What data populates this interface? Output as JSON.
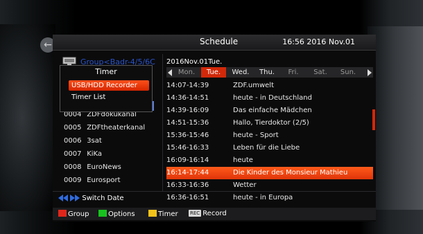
{
  "header": {
    "title": "Schedule",
    "clock": "16:56 2016 Nov.01"
  },
  "left": {
    "satellite": "Group<Badr-4/5/6C",
    "channels": [
      {
        "num": "0004",
        "name": "ZDFdokukanal"
      },
      {
        "num": "0005",
        "name": "ZDFtheaterkanal"
      },
      {
        "num": "0006",
        "name": "3sat"
      },
      {
        "num": "0007",
        "name": "KiKa"
      },
      {
        "num": "0008",
        "name": "EuroNews"
      },
      {
        "num": "0009",
        "name": "Eurosport"
      }
    ],
    "partial": [
      "0",
      "(",
      "("
    ]
  },
  "popup": {
    "title": "Timer",
    "items": [
      {
        "label": "USB/HDD Recorder",
        "selected": true
      },
      {
        "label": "Timer List",
        "selected": false
      }
    ]
  },
  "schedule": {
    "date": "2016Nov.01Tue.",
    "days": [
      "Mon.",
      "Tue.",
      "Wed.",
      "Thu.",
      "Fri.",
      "Sat.",
      "Sun."
    ],
    "selected_day": "Tue.",
    "events": [
      {
        "time": "14:07-14:39",
        "name": "ZDF.umwelt"
      },
      {
        "time": "14:36-14:51",
        "name": "heute - in Deutschland"
      },
      {
        "time": "14:39-16:09",
        "name": "Das einfache Mädchen"
      },
      {
        "time": "14:51-15:36",
        "name": "Hallo, Tierdoktor (2/5)"
      },
      {
        "time": "15:36-15:46",
        "name": "heute - Sport"
      },
      {
        "time": "15:46-16:33",
        "name": "Leben für die Liebe"
      },
      {
        "time": "16:09-16:14",
        "name": "heute"
      },
      {
        "time": "16:14-17:44",
        "name": "Die Kinder des Monsieur Mathieu",
        "selected": true
      },
      {
        "time": "16:33-16:36",
        "name": "Wetter"
      },
      {
        "time": "16:36-16:51",
        "name": "heute - in Europa"
      }
    ]
  },
  "footer": {
    "switch_date": "Switch Date",
    "legend": [
      {
        "color": "#e0261b",
        "label": "Group"
      },
      {
        "color": "#18c21f",
        "label": "Options"
      },
      {
        "color": "#f3c21a",
        "label": "Timer"
      },
      {
        "badge": "REC",
        "label": "Record"
      }
    ]
  },
  "colors": {
    "accent": "#d2290a",
    "highlight": "#ff5a1a",
    "satellite_text": "#2a53c8"
  },
  "icons": [
    "back-icon",
    "tv-icon",
    "left-arrow-icon",
    "right-arrow-icon",
    "rewind-icon",
    "fast-forward-icon"
  ]
}
